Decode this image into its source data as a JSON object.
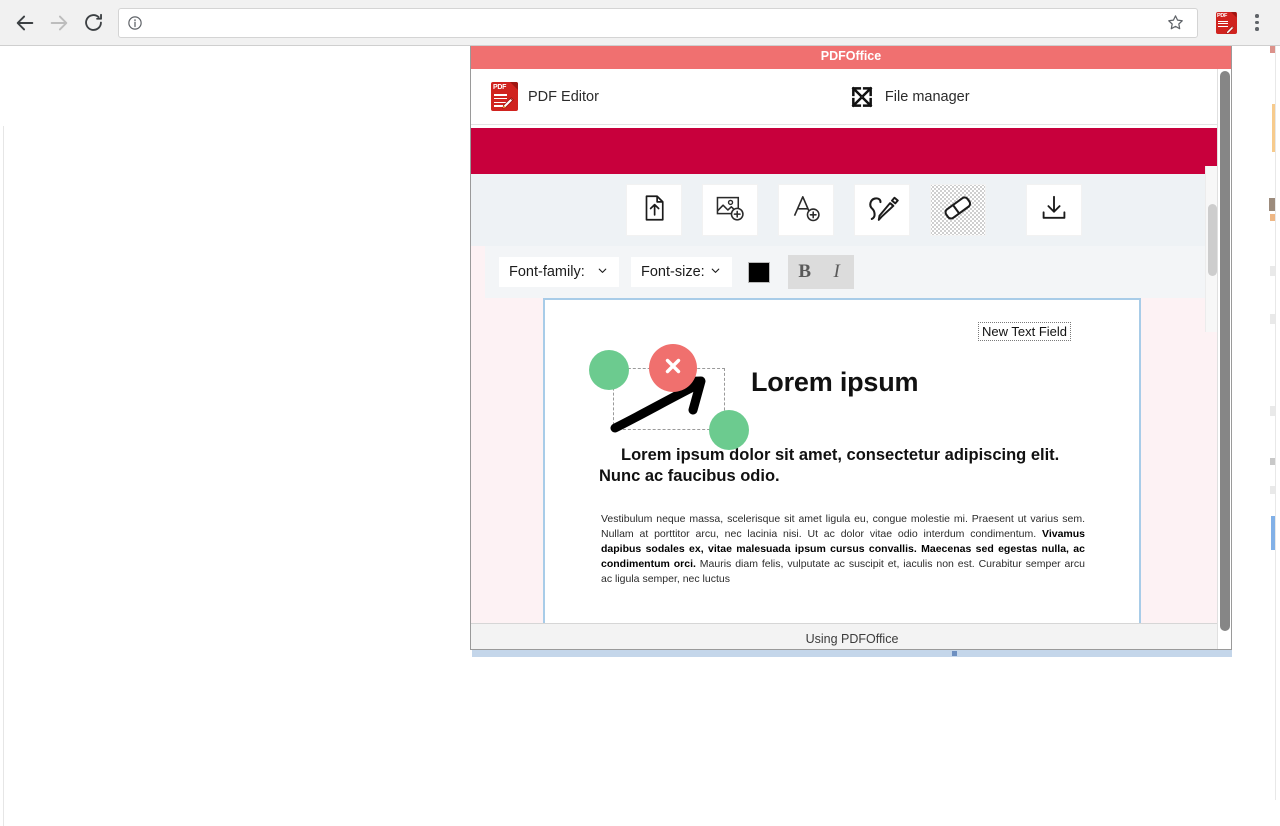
{
  "browser": {
    "back_icon": "back-arrow-icon",
    "forward_icon": "forward-arrow-icon",
    "reload_icon": "reload-icon",
    "info_icon": "info-icon",
    "address_value": "",
    "address_placeholder": "",
    "star_icon": "star-icon",
    "extension_icon": "pdf-extension-icon",
    "menu_icon": "three-dot-menu-icon"
  },
  "popup": {
    "title": "PDFOffice",
    "title_bar_color": "#f07070",
    "banner_color": "#c8003c",
    "footer_status": "Using PDFOffice",
    "nav": [
      {
        "label": "PDF Editor",
        "icon": "pdf-file-edit-icon"
      },
      {
        "label": "File manager",
        "icon": "expand-arrows-icon"
      }
    ]
  },
  "toolbar": {
    "tools": [
      {
        "name": "upload-file-button",
        "icon": "file-upload-icon",
        "active": false
      },
      {
        "name": "add-image-button",
        "icon": "image-add-icon",
        "active": false
      },
      {
        "name": "add-text-button",
        "icon": "text-add-icon",
        "active": false
      },
      {
        "name": "draw-button",
        "icon": "pencil-draw-icon",
        "active": false
      },
      {
        "name": "eraser-button",
        "icon": "eraser-icon",
        "active": true
      },
      {
        "name": "download-button",
        "icon": "download-icon",
        "active": false
      }
    ]
  },
  "font_toolbar": {
    "font_family_label": "Font-family:",
    "font_family_value": "",
    "font_size_label": "Font-size:",
    "font_size_value": "",
    "color_value": "#000000",
    "bold_label": "B",
    "italic_label": "I"
  },
  "document": {
    "new_text_field": "New Text Field",
    "title": "Lorem ipsum",
    "subtitle": "Lorem ipsum dolor sit amet, consectetur adipiscing elit. Nunc ac faucibus odio.",
    "paragraph_part1": "Vestibulum neque massa, scelerisque sit amet ligula eu, congue molestie mi. Praesent ut varius sem. Nullam at porttitor arcu, nec lacinia nisi. Ut ac dolor vitae odio interdum condimentum. ",
    "paragraph_bold": "Vivamus dapibus sodales ex, vitae malesuada ipsum cursus convallis. Maecenas sed egestas nulla, ac condimentum orci.",
    "paragraph_part2": " Mauris diam felis, vulputate ac suscipit et, iaculis non est. Curabitur semper arcu ac ligula semper, nec luctus",
    "selection": {
      "delete_icon": "close-x-icon",
      "handle_icon": "resize-handle-icon",
      "handle_color": "#6ccb8f",
      "delete_color": "#f0706e"
    }
  }
}
